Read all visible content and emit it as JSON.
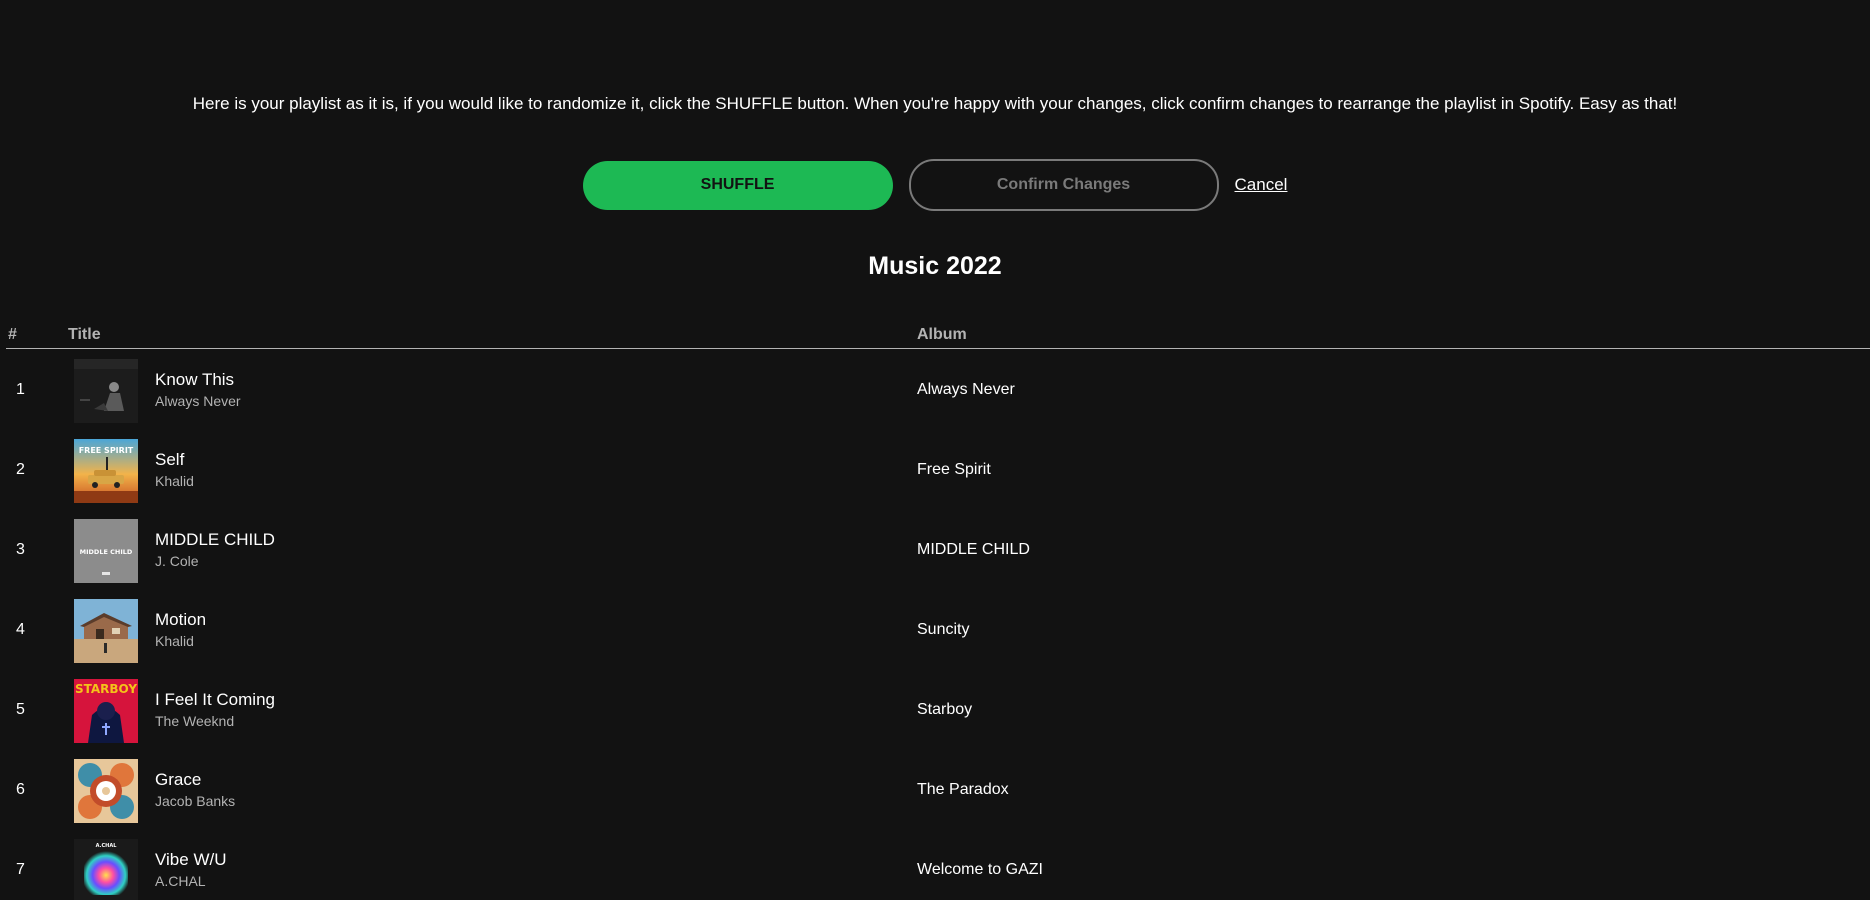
{
  "intro_text": "Here is your playlist as it is, if you would like to randomize it, click the SHUFFLE button. When you're happy with your changes, click confirm changes to rearrange the playlist in Spotify. Easy as that!",
  "actions": {
    "shuffle_label": "SHUFFLE",
    "confirm_label": "Confirm Changes",
    "cancel_label": "Cancel"
  },
  "playlist_title": "Music 2022",
  "table_headers": {
    "number": "#",
    "title": "Title",
    "album": "Album"
  },
  "tracks": [
    {
      "number": "1",
      "title": "Know This",
      "artist": "Always Never",
      "album": "Always Never",
      "cover_icon": "album-cover-dark-figure"
    },
    {
      "number": "2",
      "title": "Self",
      "artist": "Khalid",
      "album": "Free Spirit",
      "cover_icon": "album-cover-sunset-car",
      "cover_text": "FREE SPIRIT"
    },
    {
      "number": "3",
      "title": "MIDDLE CHILD",
      "artist": "J. Cole",
      "album": "MIDDLE CHILD",
      "cover_icon": "album-cover-gray-text",
      "cover_text": "MIDDLE CHILD"
    },
    {
      "number": "4",
      "title": "Motion",
      "artist": "Khalid",
      "album": "Suncity",
      "cover_icon": "album-cover-house"
    },
    {
      "number": "5",
      "title": "I Feel It Coming",
      "artist": "The Weeknd",
      "album": "Starboy",
      "cover_icon": "album-cover-starboy",
      "cover_text": "STARBOY"
    },
    {
      "number": "6",
      "title": "Grace",
      "artist": "Jacob Banks",
      "album": "The Paradox",
      "cover_icon": "album-cover-mandala"
    },
    {
      "number": "7",
      "title": "Vibe W/U",
      "artist": "A.CHAL",
      "album": "Welcome to GAZI",
      "cover_icon": "album-cover-spectrum",
      "cover_text": "A.CHAL"
    }
  ],
  "colors": {
    "background": "#121212",
    "accent": "#1db954",
    "muted_text": "#b3b3b3",
    "confirm_disabled": "#7a7a7a"
  }
}
